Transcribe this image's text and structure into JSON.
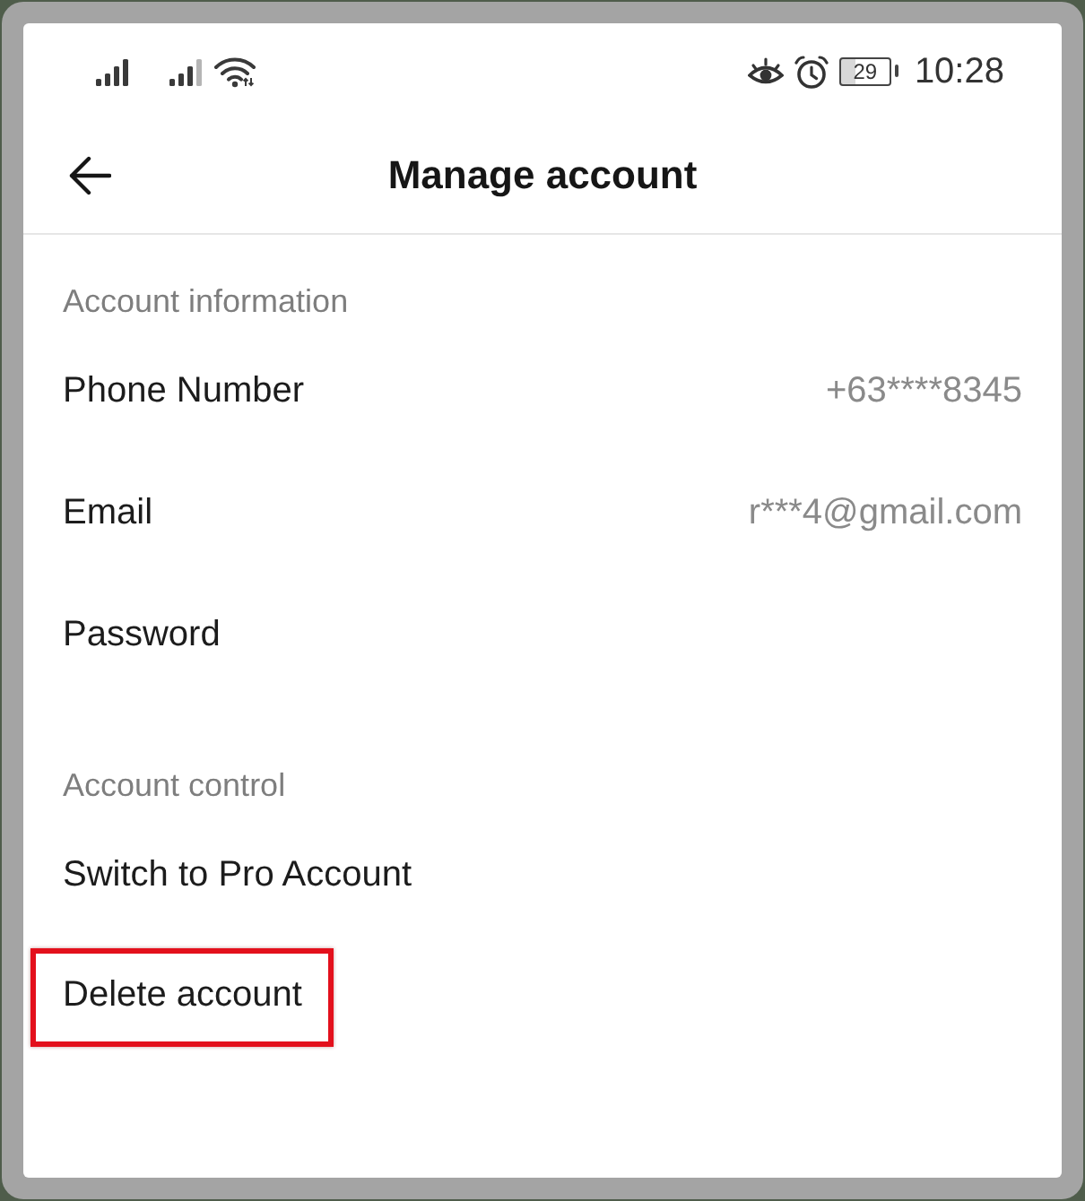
{
  "status_bar": {
    "battery": "29",
    "time": "10:28"
  },
  "header": {
    "title": "Manage account"
  },
  "sections": [
    {
      "title": "Account information",
      "items": [
        {
          "label": "Phone Number",
          "value": "+63****8345",
          "highlighted": false
        },
        {
          "label": "Email",
          "value": "r***4@gmail.com",
          "highlighted": false
        },
        {
          "label": "Password",
          "highlighted": false
        }
      ]
    },
    {
      "title": "Account control",
      "items": [
        {
          "label": "Switch to Pro Account",
          "highlighted": false
        },
        {
          "label": "Delete account",
          "highlighted": true
        }
      ]
    }
  ]
}
